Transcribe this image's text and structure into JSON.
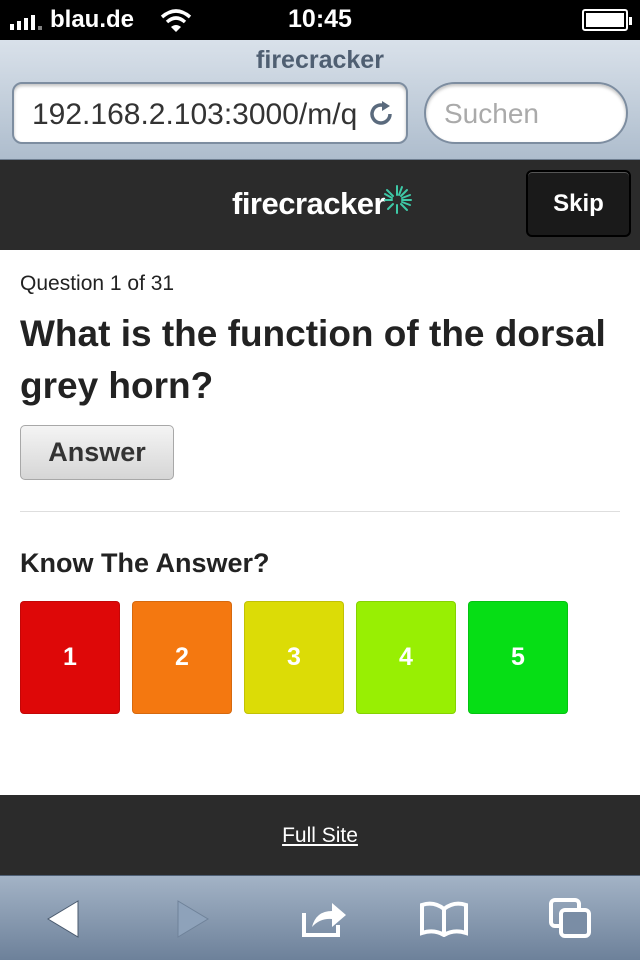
{
  "status_bar": {
    "carrier": "blau.de",
    "time": "10:45",
    "signal_icon": "signal-bars-icon",
    "wifi_icon": "wifi-icon",
    "battery_icon": "battery-icon"
  },
  "browser": {
    "page_title": "firecracker",
    "url": "192.168.2.103:3000/m/q",
    "search_placeholder": "Suchen",
    "toolbar_icons": [
      "back-icon",
      "forward-icon",
      "share-icon",
      "bookmarks-icon",
      "tabs-icon"
    ]
  },
  "header": {
    "logo_text": "firecracker",
    "skip_label": "Skip"
  },
  "question": {
    "count_text": "Question 1 of 31",
    "text": "What is the function of the dorsal grey horn?",
    "answer_label": "Answer"
  },
  "rating": {
    "heading": "Know The Answer?",
    "options": [
      {
        "label": "1",
        "color": "#de0808"
      },
      {
        "label": "2",
        "color": "#f47810"
      },
      {
        "label": "3",
        "color": "#dcdc06"
      },
      {
        "label": "4",
        "color": "#98ef03"
      },
      {
        "label": "5",
        "color": "#06de15"
      }
    ]
  },
  "footer": {
    "full_site_label": "Full Site"
  },
  "colors": {
    "brand_spark": "#3ec9a7",
    "header_bg": "#2b2b2b"
  }
}
